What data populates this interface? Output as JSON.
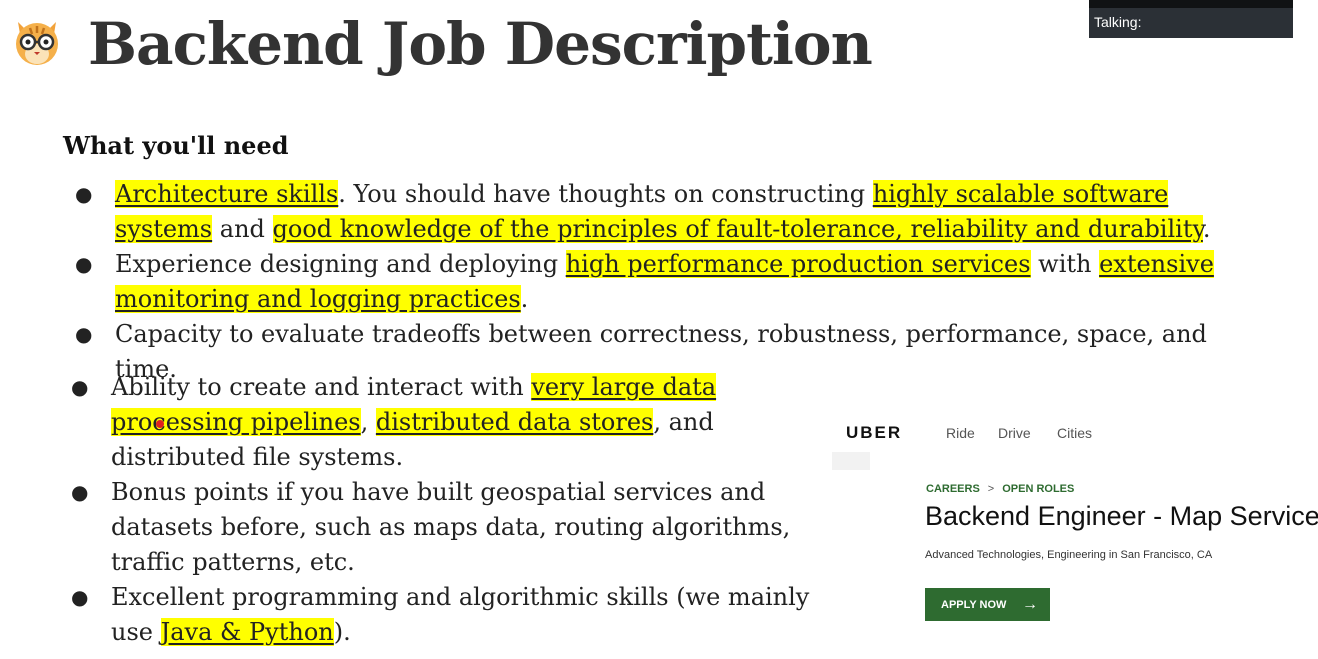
{
  "header": {
    "title": "Backend Job Description",
    "talking_label": "Talking:"
  },
  "subhead": "What you'll need",
  "list_one": [
    {
      "parts": [
        {
          "text": "Architecture skills",
          "hl": true
        },
        {
          "text": ". You should have thoughts on constructing ",
          "hl": false
        },
        {
          "text": "highly scalable software systems",
          "hl": true
        },
        {
          "text": " and ",
          "hl": false
        },
        {
          "text": "good knowledge of the principles of fault-tolerance, reliability and durability",
          "hl": true
        },
        {
          "text": ".",
          "hl": false
        }
      ]
    },
    {
      "parts": [
        {
          "text": "Experience designing and deploying ",
          "hl": false
        },
        {
          "text": "high performance production services",
          "hl": true
        },
        {
          "text": " with ",
          "hl": false
        },
        {
          "text": "extensive monitoring and logging practices",
          "hl": true
        },
        {
          "text": ".",
          "hl": false
        }
      ]
    },
    {
      "parts": [
        {
          "text": "Capacity to evaluate tradeoffs between correctness, robustness, performance, space, and time.",
          "hl": false
        }
      ]
    }
  ],
  "list_two": [
    {
      "parts": [
        {
          "text": "Ability to create and interact with ",
          "hl": false
        },
        {
          "text": "very large data processing pipelines",
          "hl": true
        },
        {
          "text": ", ",
          "hl": false
        },
        {
          "text": "distributed data stores",
          "hl": true
        },
        {
          "text": ", and distributed file systems.",
          "hl": false
        }
      ]
    },
    {
      "parts": [
        {
          "text": "Bonus points if you have built geospatial services and datasets before, such as maps data, routing algorithms, traffic patterns, etc.",
          "hl": false
        }
      ]
    },
    {
      "parts": [
        {
          "text": "Excellent programming and algorithmic skills (we mainly use ",
          "hl": false
        },
        {
          "text": "Java & Python",
          "hl": true
        },
        {
          "text": ").",
          "hl": false
        }
      ]
    }
  ],
  "bullet_glyph": "●",
  "highlight_color": "#ffff00",
  "uber": {
    "wordmark": "UBER",
    "nav": [
      "Ride",
      "Drive",
      "Cities"
    ],
    "breadcrumb": [
      "CAREERS",
      "OPEN ROLES"
    ],
    "breadcrumb_sep": ">",
    "job_title": "Backend Engineer - Map Services",
    "job_subtitle": "Advanced Technologies, Engineering in San Francisco, CA",
    "apply_label": "APPLY NOW",
    "apply_icon": "arrow-right-icon",
    "apply_arrow": "→",
    "accent": "#2e6b30"
  }
}
